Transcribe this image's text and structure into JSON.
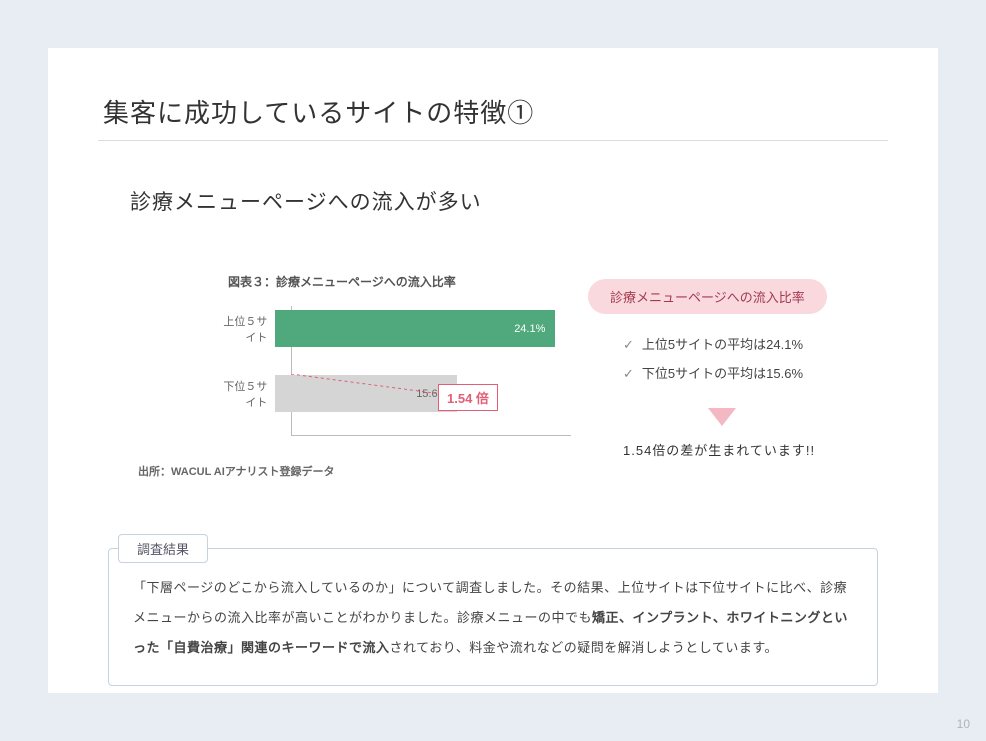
{
  "page_number": "10",
  "title": "集客に成功しているサイトの特徴①",
  "subhead": "診療メニューページへの流入が多い",
  "chart_data": {
    "type": "bar",
    "title": "図表３：診療メニューページへの流入比率",
    "categories": [
      "上位５サイト",
      "下位５サイト"
    ],
    "values": [
      24.1,
      15.6
    ],
    "value_labels": [
      "24.1%",
      "15.6%"
    ],
    "xlabel": "",
    "ylabel": "",
    "ratio_callout": "1.54 倍",
    "source": "出所：WACUL AIアナリスト登録データ"
  },
  "summary": {
    "pill": "診療メニューページへの流入比率",
    "bullets": [
      "上位5サイトの平均は24.1%",
      "下位5サイトの平均は15.6%"
    ],
    "diff": "1.54倍の差が生まれています!!"
  },
  "findings": {
    "label": "調査結果",
    "text_pre": "「下層ページのどこから流入しているのか」について調査しました。その結果、上位サイトは下位サイトに比べ、診療メニューからの流入比率が高いことがわかりました。診療メニューの中でも",
    "text_bold": "矯正、インプラント、ホワイトニングといった「自費治療」関連のキーワードで流入",
    "text_post": "されており、料金や流れなどの疑問を解消しようとしています。"
  }
}
